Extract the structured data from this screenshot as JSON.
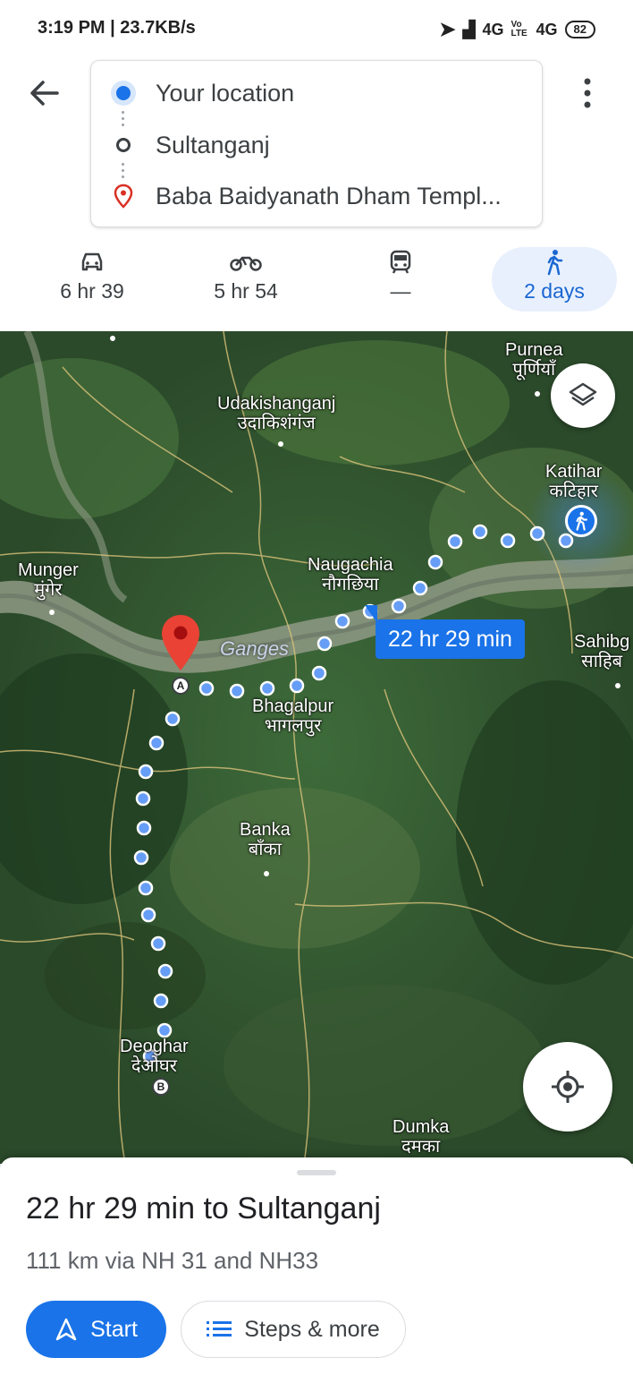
{
  "status_bar": {
    "time": "3:19 PM | 23.7KB/s",
    "network": "4G",
    "volte": "Vo LTE",
    "network2": "4G",
    "battery": "82"
  },
  "route": {
    "stops": [
      {
        "label": "Your location",
        "icon": "your-location-dot"
      },
      {
        "label": "Sultanganj",
        "icon": "waypoint-circle"
      },
      {
        "label": "Baba Baidyanath Dham Templ...",
        "icon": "destination-pin"
      }
    ]
  },
  "modes": [
    {
      "icon": "car-icon",
      "label": "6 hr 39"
    },
    {
      "icon": "motorbike-icon",
      "label": "5 hr 54"
    },
    {
      "icon": "transit-icon",
      "label": "—"
    },
    {
      "icon": "walk-icon",
      "label": "2 days",
      "active": true
    }
  ],
  "map": {
    "places": {
      "purnea_en": "Purnea",
      "purnea_hi": "पूर्णियाँ",
      "udaki_en": "Udakishanganj",
      "udaki_hi": "उदाकिशंगंज",
      "katihar_en": "Katihar",
      "katihar_hi": "कटिहार",
      "munger_en": "Munger",
      "munger_hi": "मुंगेर",
      "naugachia_en": "Naugachia",
      "naugachia_hi": "नौगछिया",
      "sahib_en": "Sahibg",
      "sahib_hi": "साहिब",
      "bhagalpur_en": "Bhagalpur",
      "bhagalpur_hi": "भागलपुर",
      "banka_en": "Banka",
      "banka_hi": "बाँका",
      "deoghar_en": "Deoghar",
      "deoghar_hi": "देओघर",
      "dumka_en": "Dumka",
      "dumka_hi": "दमका"
    },
    "river": "Ganges",
    "duration_pill": "22 hr 29 min",
    "marker_a": "A",
    "marker_b": "B"
  },
  "sheet": {
    "summary": "22 hr 29 min to Sultanganj",
    "detail": "111 km  via NH 31 and NH33",
    "start_label": "Start",
    "steps_label": "Steps & more"
  },
  "colors": {
    "accent": "#1a73e8",
    "pin": "#d93025"
  }
}
